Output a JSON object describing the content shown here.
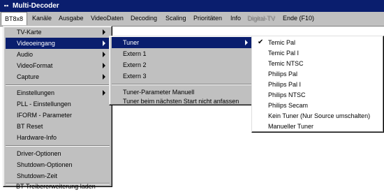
{
  "window": {
    "title": "Multi-Decoder"
  },
  "menubar": [
    "BT8x8",
    "Kanäle",
    "Ausgabe",
    "VideoDaten",
    "Decoding",
    "Scaling",
    "Prioritäten",
    "Info",
    "Digital-TV",
    "Ende (F10)"
  ],
  "bt_menu": [
    "TV-Karte",
    "Videoeingang",
    "Audio",
    "VideoFormat",
    "Capture",
    "Einstellungen",
    "PLL - Einstellungen",
    "IFORM - Parameter",
    "BT Reset",
    "Hardware-Info",
    "Driver-Optionen",
    "Shutdown-Optionen",
    "Shutdown-Zeit",
    "BT-Treibererweiterung laden"
  ],
  "videoeingang_menu": [
    "Tuner",
    "Extern 1",
    "Extern 2",
    "Extern 3",
    "Tuner-Parameter Manuell",
    "Tuner beim nächsten Start nicht anfassen"
  ],
  "tuner_menu": [
    "Temic Pal",
    "Temic Pal I",
    "Temic NTSC",
    "Philips Pal",
    "Philips Pal I",
    "Philips NTSC",
    "Philips Secam",
    "Kein Tuner (Nur Source umschalten)",
    "Manueller Tuner"
  ],
  "check_mark": "✔",
  "sys_icon": "▪▪"
}
